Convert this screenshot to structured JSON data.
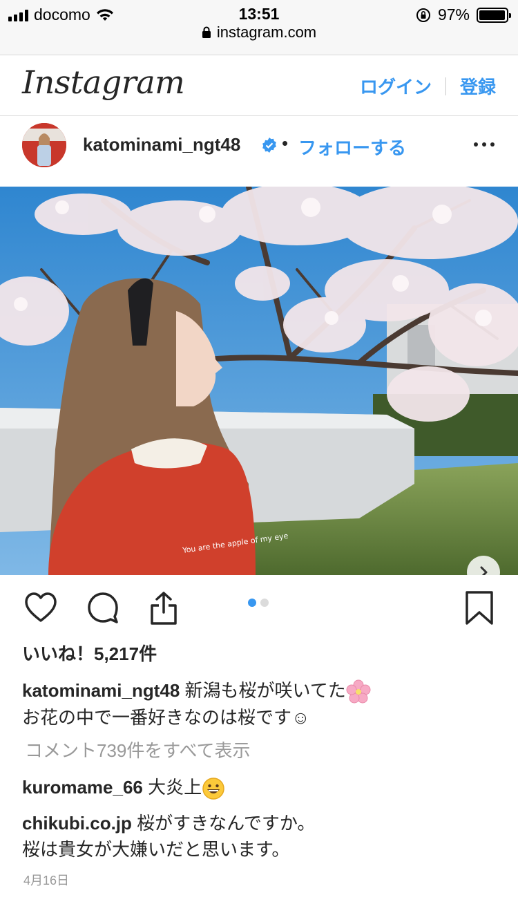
{
  "status_bar": {
    "carrier": "docomo",
    "time": "13:51",
    "battery": "97%",
    "battery_level": 0.97,
    "url": "instagram.com"
  },
  "header": {
    "logo": "Instagram",
    "login": "ログイン",
    "signup": "登録"
  },
  "post": {
    "username": "katominami_ngt48",
    "dot": "•",
    "follow": "フォローする",
    "likes": "いいね！5,217件",
    "caption_user": "katominami_ngt48",
    "caption_line1": "新潟も桜が咲いてた",
    "caption_line2": "お花の中で一番好きなのは桜です☺",
    "view_all_comments": "コメント739件をすべて表示",
    "comments": [
      {
        "user": "kuromame_66",
        "text": "大炎上"
      },
      {
        "user": "chikubi.co.jp",
        "text": "桜がすきなんですか。",
        "text2": "桜は貴女が大嫌いだと思います。"
      }
    ],
    "date": "4月16日",
    "carousel_pages": 2,
    "carousel_current": 1
  },
  "colors": {
    "accent": "#3897f0",
    "text": "#262626",
    "muted": "#999999",
    "sweater": "#d0402c",
    "sky": "#3e8fd3"
  }
}
